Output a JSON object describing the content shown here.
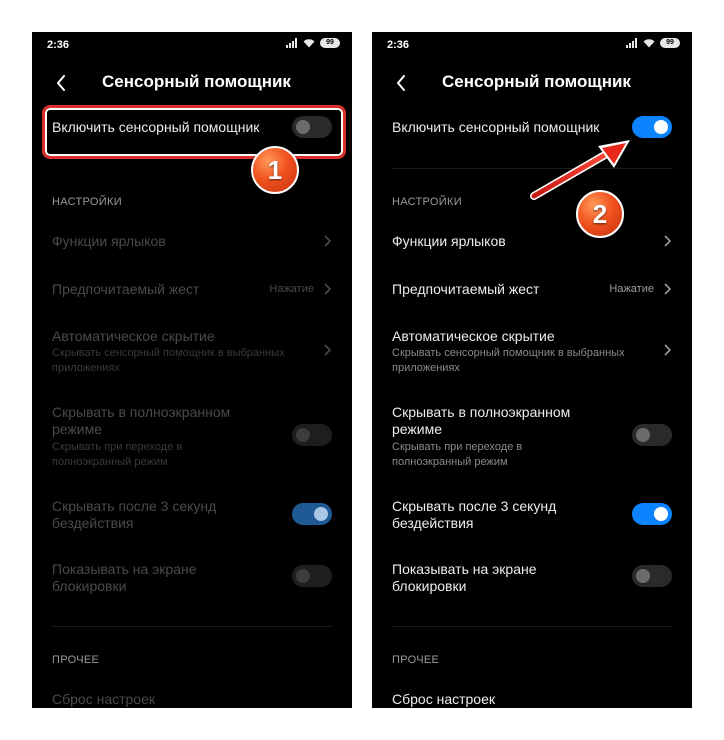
{
  "status": {
    "time": "2:36",
    "battery": "99"
  },
  "screen": {
    "title": "Сенсорный помощник",
    "enable_label": "Включить сенсорный помощник",
    "settings_header": "НАСТРОЙКИ",
    "shortcuts_label": "Функции ярлыков",
    "gesture_label": "Предпочитаемый жест",
    "gesture_value": "Нажатие",
    "autohide_title": "Автоматическое скрытие",
    "autohide_sub_1": "Скрывать сенсорный помощник в выбранных",
    "autohide_sub_2": "приложениях",
    "fullscreen_title_1": "Скрывать в полноэкранном",
    "fullscreen_title_2": "режиме",
    "fullscreen_sub_1": "Скрывать при переходе в",
    "fullscreen_sub_2": "полноэкранный режим",
    "idle_title_1": "Скрывать после 3 секунд",
    "idle_title_2": "бездействия",
    "lockscreen_title_1": "Показывать на экране",
    "lockscreen_title_2": "блокировки",
    "other_header": "ПРОЧЕЕ",
    "reset_label": "Сброс настроек"
  },
  "annotations": {
    "step1": "1",
    "step2": "2"
  },
  "states": {
    "left": {
      "enabled": false,
      "fullscreen_hide": false,
      "idle_hide": true,
      "lockscreen_show": false
    },
    "right": {
      "enabled": true,
      "fullscreen_hide": false,
      "idle_hide": true,
      "lockscreen_show": false
    }
  },
  "colors": {
    "toggle_on": "#0d84ff",
    "highlight": "#d8302a",
    "badge": "#f0521f",
    "arrow": "#e8281c"
  },
  "icons": {
    "back": "back-arrow-icon",
    "chevron": "chevron-right-icon",
    "signal": "signal-icon",
    "wifi": "wifi-icon",
    "battery": "battery-icon"
  }
}
